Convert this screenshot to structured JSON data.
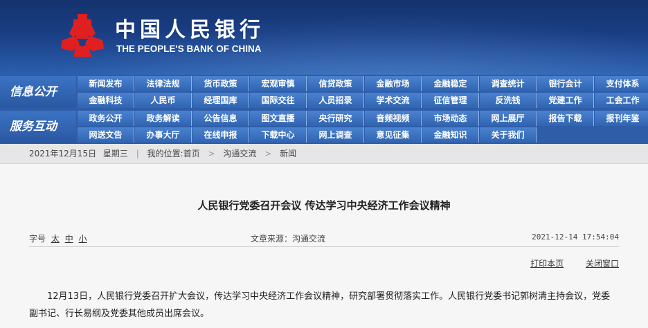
{
  "brand": {
    "name_cn": "中国人民银行",
    "name_en": "THE PEOPLE'S BANK OF CHINA",
    "logo_color": "#e02020"
  },
  "nav": {
    "row1_label": "信息公开",
    "row2_label": "服务互动",
    "row1": [
      [
        "新闻发布",
        "法律法规",
        "货币政策",
        "宏观审慎",
        "信贷政策",
        "金融市场",
        "金融稳定",
        "调查统计",
        "银行会计",
        "支付体系"
      ],
      [
        "金融科技",
        "人民币",
        "经理国库",
        "国际交往",
        "人员招录",
        "学术交流",
        "征信管理",
        "反洗钱",
        "党建工作",
        "工会工作"
      ]
    ],
    "row2": [
      [
        "政务公开",
        "政务解读",
        "公告信息",
        "图文直播",
        "央行研究",
        "音频视频",
        "市场动态",
        "网上展厅",
        "报告下载",
        "报刊年鉴"
      ],
      [
        "网送文告",
        "办事大厅",
        "在线申报",
        "下载中心",
        "网上调查",
        "意见征集",
        "金融知识",
        "关于我们"
      ]
    ]
  },
  "breadcrumb": {
    "date": "2021年12月15日",
    "weekday": "星期三",
    "location_prefix": "我的位置:",
    "home": "首页",
    "section": "沟通交流",
    "current": "新闻"
  },
  "article": {
    "title": "人民银行党委召开会议 传达学习中央经济工作会议精神",
    "font_size_label": "字号",
    "font_large": "太",
    "font_medium": "中",
    "font_small": "小",
    "source": "文章来源：沟通交流",
    "datetime": "2021-12-14 17:54:04",
    "print_label": "打印本页",
    "close_label": "关闭窗口",
    "body": "12月13日，人民银行党委召开扩大会议，传达学习中央经济工作会议精神，研究部署贯彻落实工作。人民银行党委书记郭树清主持会议，党委副书记、行长易纲及党委其他成员出席会议。"
  }
}
